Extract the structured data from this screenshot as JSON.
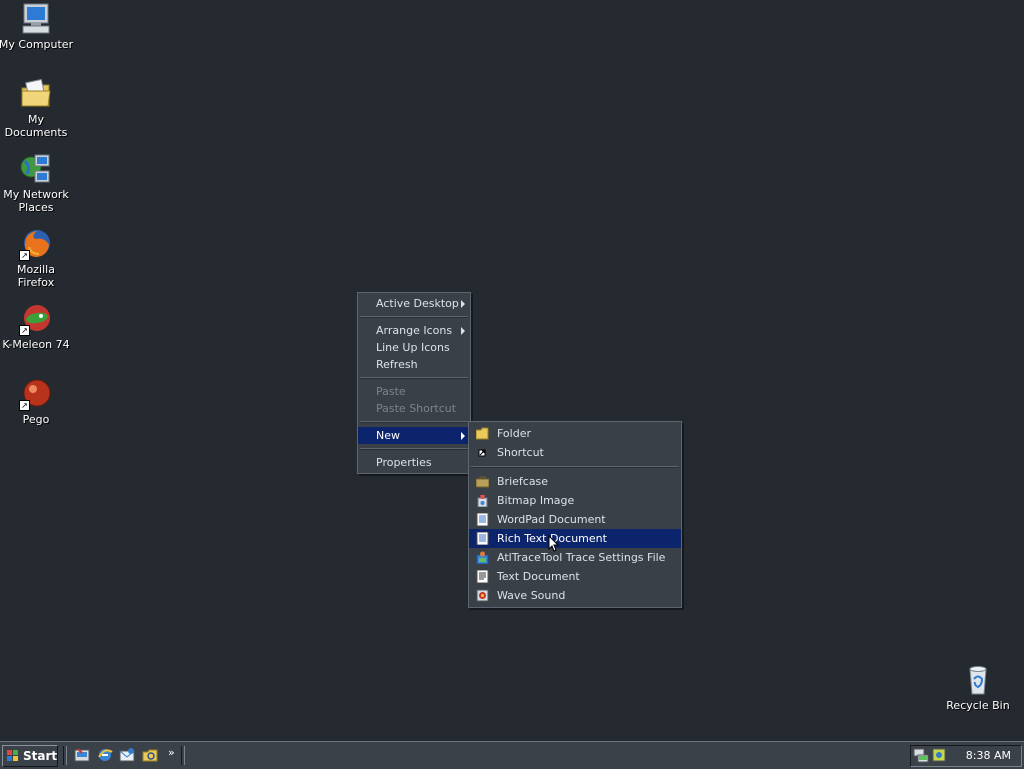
{
  "desktop_icons": [
    {
      "label": "My Computer",
      "icon": "my-computer-icon"
    },
    {
      "label": "My Documents",
      "icon": "my-documents-icon"
    },
    {
      "label": "My Network Places",
      "icon": "network-places-icon"
    },
    {
      "label": "Mozilla Firefox",
      "icon": "firefox-icon"
    },
    {
      "label": "K-Meleon 74",
      "icon": "k-meleon-icon"
    },
    {
      "label": "Pego",
      "icon": "pego-icon"
    },
    {
      "label": "Recycle Bin",
      "icon": "recycle-bin-icon"
    }
  ],
  "context_menu": {
    "items": [
      {
        "label": "Active Desktop",
        "submenu": true
      },
      {
        "label": "Arrange Icons",
        "submenu": true
      },
      {
        "label": "Line Up Icons"
      },
      {
        "label": "Refresh"
      },
      {
        "label": "Paste",
        "disabled": true
      },
      {
        "label": "Paste Shortcut",
        "disabled": true
      },
      {
        "label": "New",
        "submenu": true,
        "highlighted": true
      },
      {
        "label": "Properties"
      }
    ]
  },
  "new_submenu": {
    "items": [
      {
        "label": "Folder",
        "icon": "folder-icon",
        "accel": "F"
      },
      {
        "label": "Shortcut",
        "icon": "shortcut-icon",
        "accel": "S"
      },
      {
        "label": "Briefcase",
        "icon": "briefcase-icon"
      },
      {
        "label": "Bitmap Image",
        "icon": "bitmap-icon"
      },
      {
        "label": "WordPad Document",
        "icon": "wordpad-icon"
      },
      {
        "label": "Rich Text Document",
        "icon": "rich-text-icon",
        "highlighted": true
      },
      {
        "label": "AtlTraceTool Trace Settings File",
        "icon": "trace-settings-icon"
      },
      {
        "label": "Text Document",
        "icon": "text-document-icon"
      },
      {
        "label": "Wave Sound",
        "icon": "wave-sound-icon"
      }
    ]
  },
  "taskbar": {
    "start_label": "Start",
    "overflow_chevron": "»",
    "clock": "8:38 AM"
  },
  "colors": {
    "desktop": "#252a30",
    "menu_bg": "#3a4048",
    "highlight": "#0b246b"
  }
}
